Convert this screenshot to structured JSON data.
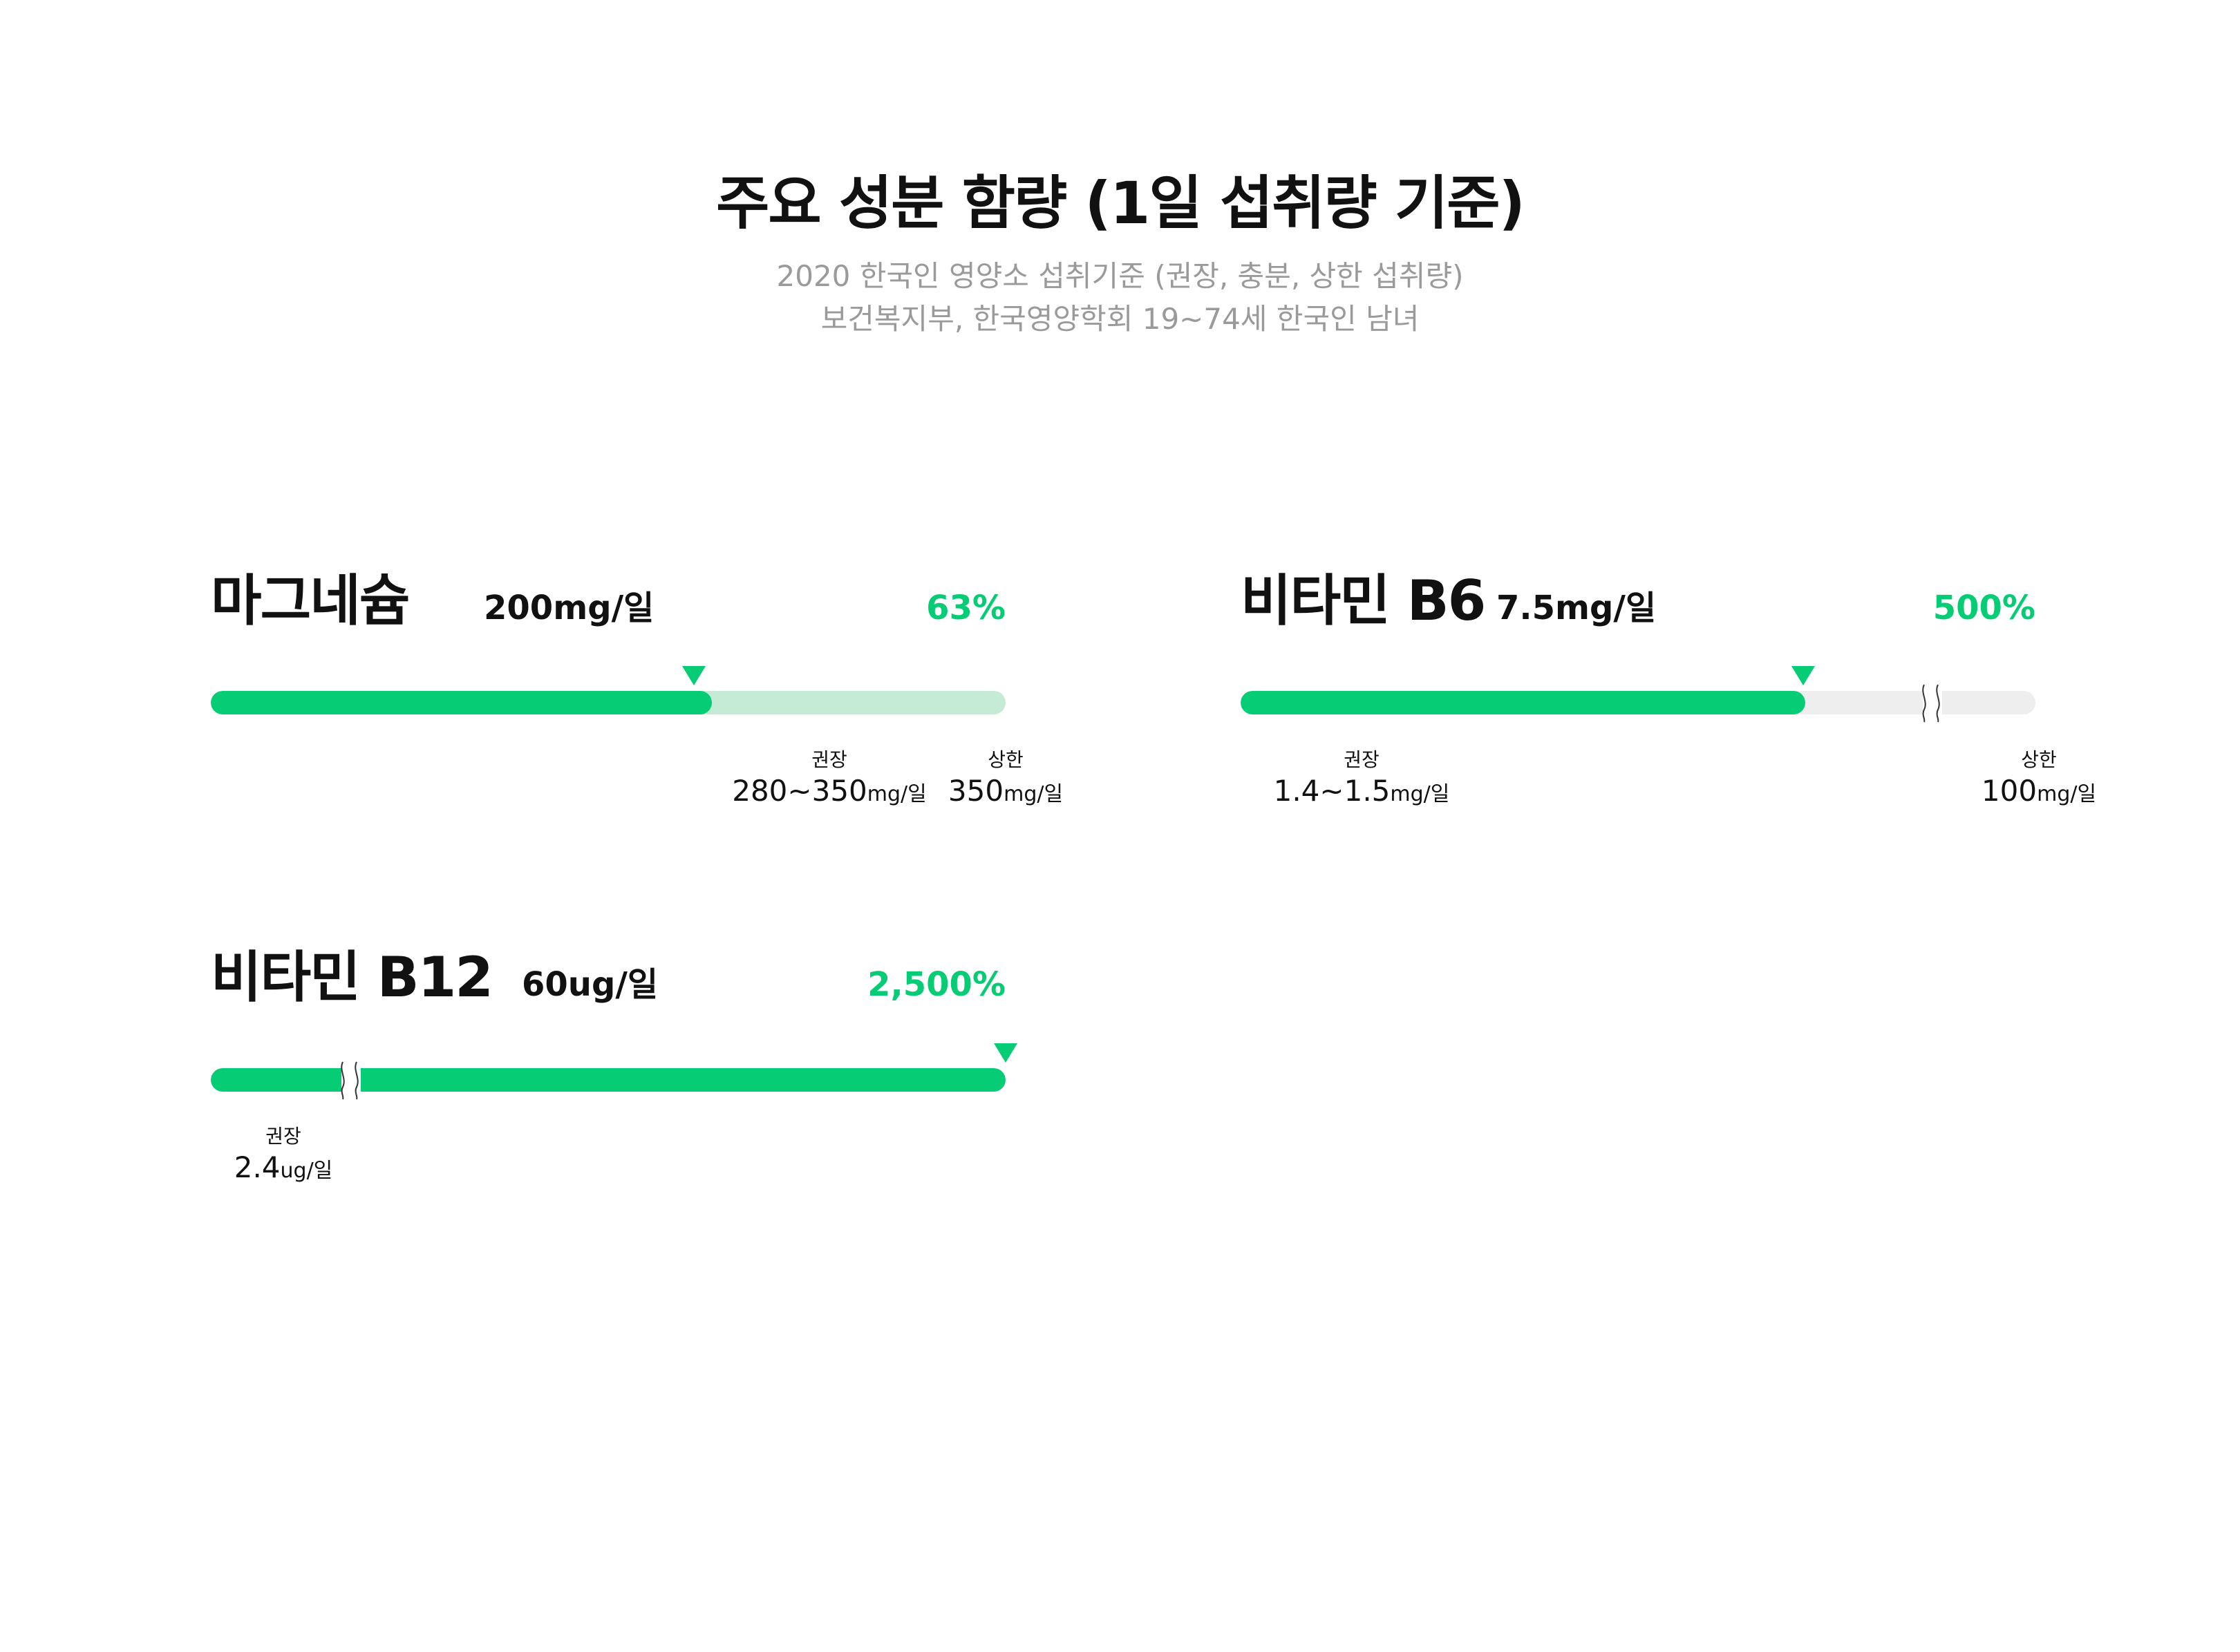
{
  "header": {
    "title": "주요 성분 함량 (1일 섭취량 기준)",
    "subtitle_line1": "2020 한국인 영양소 섭취기준 (권장, 충분, 상한 섭취량)",
    "subtitle_line2": "보건복지부, 한국영양학회  19~74세 한국인 남녀"
  },
  "colors": {
    "accent": "#05cc75",
    "track_light_green": "#c5ead6",
    "track_gray": "#eeeeee",
    "subtitle": "#9a9a9a",
    "text": "#111111"
  },
  "chart_data": [
    {
      "type": "bar",
      "title": "마그네슘",
      "amount": "200mg/일",
      "percent_label": "63%",
      "value": 0.63,
      "track_color": "track_light_green",
      "references": [
        {
          "label": "권장",
          "value": "280~350",
          "unit": "mg/일"
        },
        {
          "label": "상한",
          "value": "350",
          "unit": "mg/일"
        }
      ]
    },
    {
      "type": "bar",
      "title": "비타민 B6",
      "amount": "7.5mg/일",
      "percent_label": "500%",
      "value": 5.0,
      "track_color": "track_gray",
      "axis_break": true,
      "references": [
        {
          "label": "권장",
          "value": "1.4~1.5",
          "unit": "mg/일"
        },
        {
          "label": "상한",
          "value": "100",
          "unit": "mg/일"
        }
      ]
    },
    {
      "type": "bar",
      "title": "비타민 B12",
      "amount": "60ug/일",
      "percent_label": "2,500%",
      "value": 25.0,
      "axis_break": true,
      "references": [
        {
          "label": "권장",
          "value": "2.4",
          "unit": "ug/일"
        }
      ]
    }
  ]
}
